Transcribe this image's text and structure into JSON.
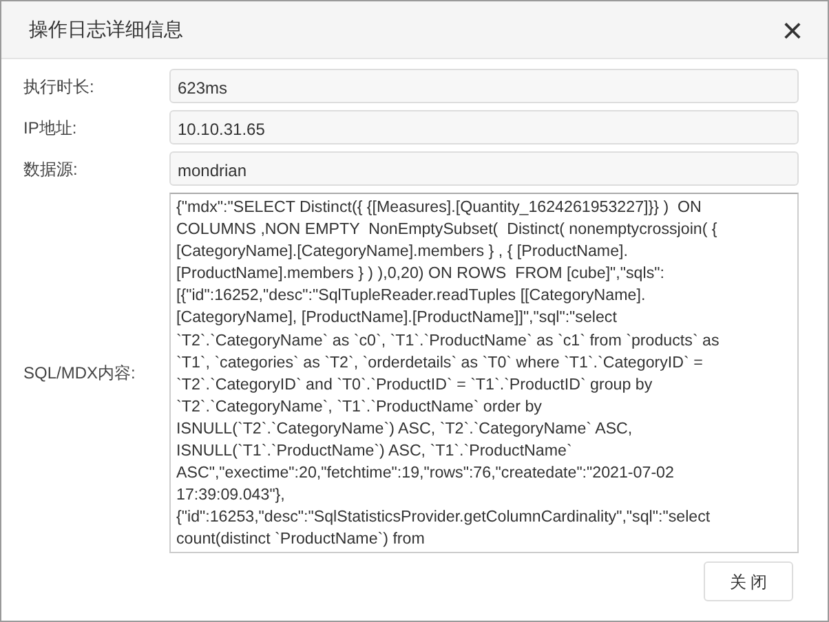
{
  "window": {
    "title": "操作日志详细信息",
    "close": "×"
  },
  "fields": [
    {
      "label": "执行时长:",
      "value": "623ms"
    },
    {
      "label": "IP地址:",
      "value": "10.10.31.65"
    },
    {
      "label": "数据源:",
      "value": "mondrian"
    }
  ],
  "detail": {
    "label": "SQL/MDX内容:",
    "lines": [
      "{\"mdx\":\"SELECT Distinct({ {[Measures].[Quantity_1624261953227]}} )  ON",
      "COLUMNS ,NON EMPTY  NonEmptySubset(  Distinct( nonemptycrossjoin( {",
      "[CategoryName].[CategoryName].members } , { [ProductName].",
      "[ProductName].members } ) ),0,20) ON ROWS  FROM [cube]\",\"sqls\":",
      "[{\"id\":16252,\"desc\":\"SqlTupleReader.readTuples [[CategoryName].",
      "[CategoryName], [ProductName].[ProductName]]\",\"sql\":\"select",
      "`T2`.`CategoryName` as `c0`, `T1`.`ProductName` as `c1` from `products` as",
      "`T1`, `categories` as `T2`, `orderdetails` as `T0` where `T1`.`CategoryID` =",
      "`T2`.`CategoryID` and `T0`.`ProductID` = `T1`.`ProductID` group by",
      "`T2`.`CategoryName`, `T1`.`ProductName` order by",
      "ISNULL(`T2`.`CategoryName`) ASC, `T2`.`CategoryName` ASC,",
      "ISNULL(`T1`.`ProductName`) ASC, `T1`.`ProductName`",
      "ASC\",\"exectime\":20,\"fetchtime\":19,\"rows\":76,\"createdate\":\"2021-07-02",
      "17:39:09.043\"},",
      "{\"id\":16253,\"desc\":\"SqlStatisticsProvider.getColumnCardinality\",\"sql\":\"select",
      "count(distinct `ProductName`) from"
    ]
  },
  "buttons": [
    "关 闭"
  ]
}
